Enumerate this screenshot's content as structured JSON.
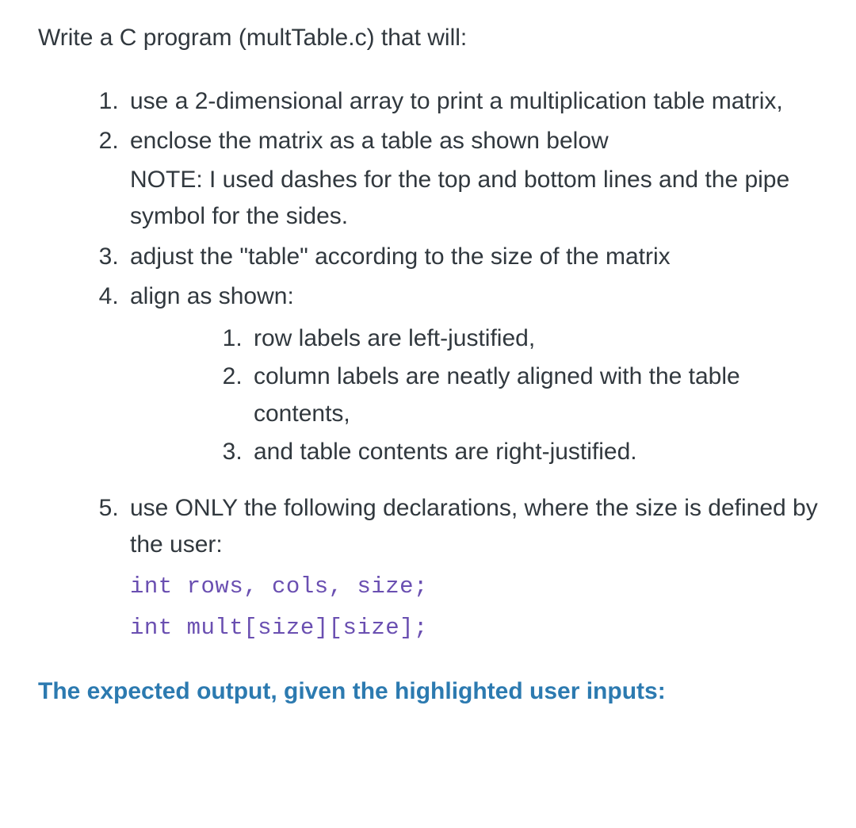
{
  "intro": "Write a C program (multTable.c) that will:",
  "list": {
    "item1": "use a 2-dimensional array to print a multiplication table matrix,",
    "item2": {
      "main": "enclose the matrix as a table as shown below",
      "note": "NOTE: I used dashes for the top and bottom lines and the pipe symbol for the sides."
    },
    "item3": "adjust the \"table\" according to the size of the matrix",
    "item4": {
      "main": "align as shown:",
      "sub1": "row labels are left-justified,",
      "sub2": "column labels are neatly aligned with the table contents,",
      "sub3": "and table contents are right-justified."
    },
    "item5": {
      "main": "use ONLY the following declarations, where the size is defined by the user:",
      "code1": "int rows, cols, size;",
      "code2": "int mult[size][size];"
    }
  },
  "expected": "The expected output, given the highlighted user inputs:"
}
